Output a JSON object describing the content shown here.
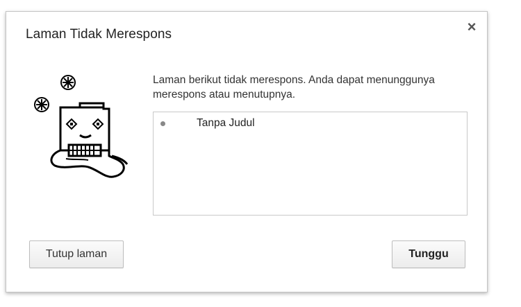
{
  "dialog": {
    "title": "Laman Tidak Merespons",
    "close_glyph": "×",
    "message": "Laman berikut tidak merespons. Anda dapat menunggunya merespons atau menutupnya.",
    "pages": [
      {
        "label": "Tanpa Judul"
      }
    ],
    "buttons": {
      "kill_label": "Tutup laman",
      "wait_label": "Tunggu"
    },
    "icon": "sad-tab-icon"
  }
}
